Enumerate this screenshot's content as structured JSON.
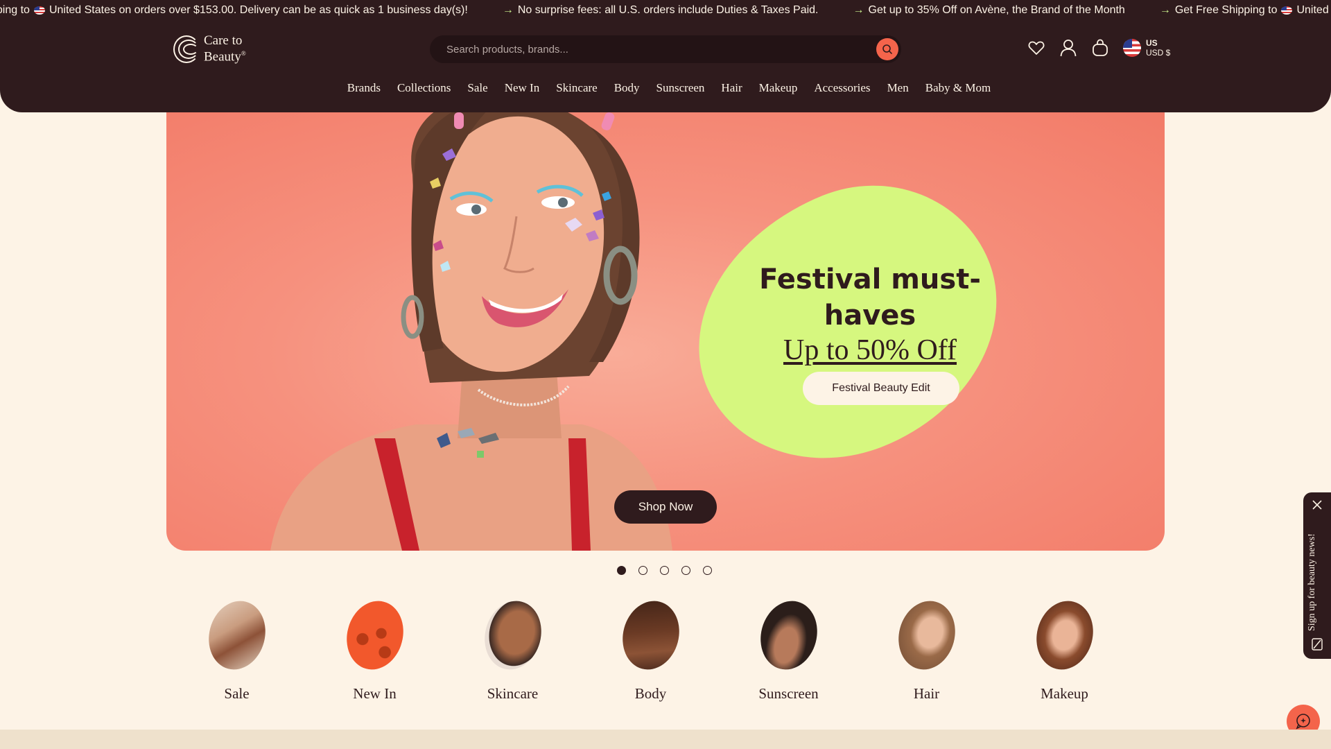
{
  "announcement_bar": {
    "items": [
      "pping to",
      "United States on orders over $153.00. Delivery can be as quick as 1 business day(s)!",
      "No surprise fees: all U.S. orders include Duties & Taxes Paid.",
      "Get up to 35% Off on Avène, the Brand of the Month",
      "Get Free Shipping to",
      "United S"
    ]
  },
  "header": {
    "logo_line1": "Care to",
    "logo_line2": "Beauty",
    "logo_mark": "®",
    "search_placeholder": "Search products, brands...",
    "locale_country": "US",
    "locale_currency": "USD $"
  },
  "nav": [
    "Brands",
    "Collections",
    "Sale",
    "New In",
    "Skincare",
    "Body",
    "Sunscreen",
    "Hair",
    "Makeup",
    "Accessories",
    "Men",
    "Baby & Mom"
  ],
  "hero": {
    "title": "Festival must-haves",
    "offer": "Up to 50% Off",
    "edit_button": "Festival Beauty Edit",
    "shop_button": "Shop Now",
    "slide_count": 5,
    "active_slide": 1
  },
  "categories": [
    "Sale",
    "New In",
    "Skincare",
    "Body",
    "Sunscreen",
    "Hair",
    "Makeup"
  ],
  "newsletter_tab": {
    "label": "Sign up for beauty news!"
  },
  "colors": {
    "header_bg": "#2f1b1d",
    "page_bg": "#fdf3e6",
    "accent_coral": "#f4644b",
    "hero_bg": "#f6917e",
    "blob_lime": "#d6f77f"
  }
}
